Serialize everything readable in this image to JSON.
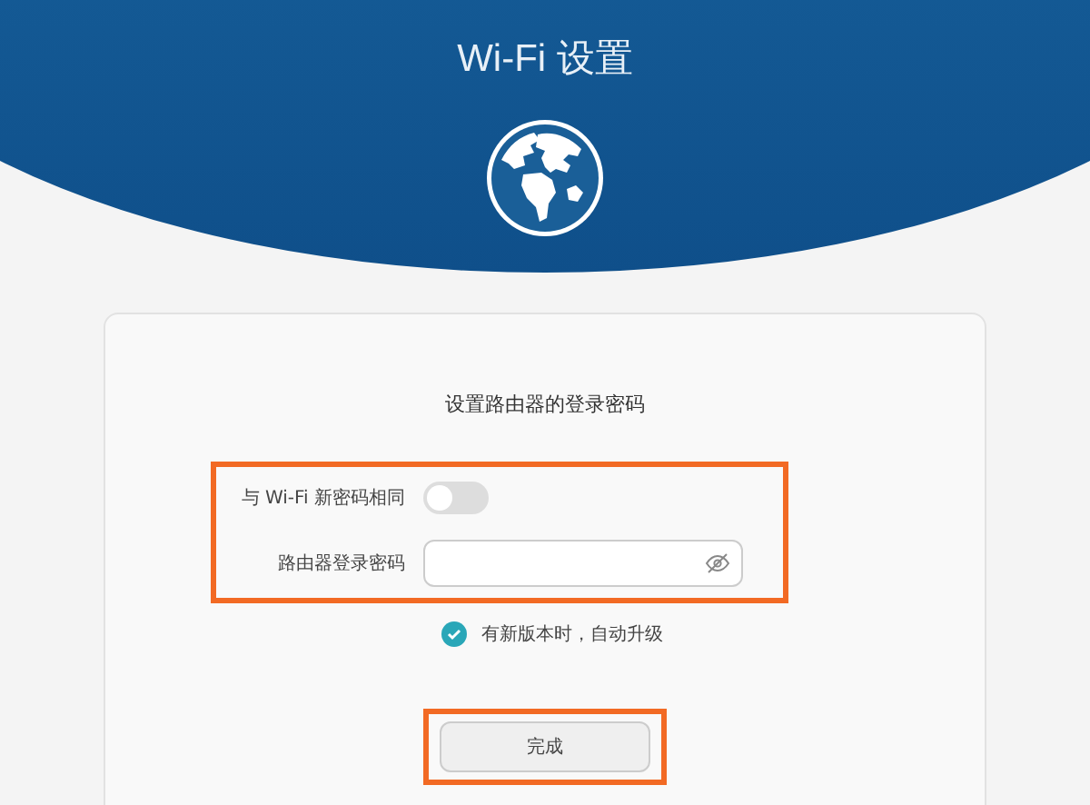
{
  "header": {
    "title": "Wi-Fi 设置"
  },
  "form": {
    "title": "设置路由器的登录密码",
    "same_as_wifi": {
      "label": "与 Wi-Fi 新密码相同",
      "on": false
    },
    "password": {
      "label": "路由器登录密码"
    },
    "auto_upgrade": {
      "label": "有新版本时，自动升级",
      "checked": true
    },
    "button": {
      "label": "完成"
    }
  }
}
